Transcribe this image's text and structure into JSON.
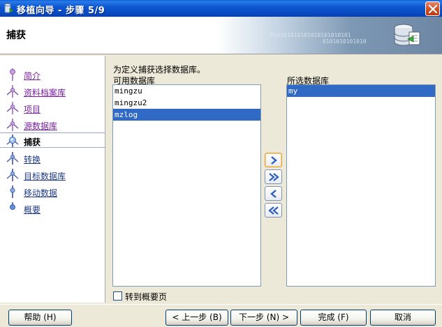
{
  "window": {
    "title": "移植向导 - 步骤 5/9"
  },
  "header": {
    "page_title": "捕获",
    "banner_binary_1": "010101010101010101010101",
    "banner_binary_2": "0101010101010"
  },
  "steps": [
    {
      "label": "简介",
      "state": "visited"
    },
    {
      "label": "资料档案库",
      "state": "visited"
    },
    {
      "label": "项目",
      "state": "visited"
    },
    {
      "label": "源数据库",
      "state": "visited"
    },
    {
      "label": "捕获",
      "state": "current"
    },
    {
      "label": "转换",
      "state": "future"
    },
    {
      "label": "目标数据库",
      "state": "future"
    },
    {
      "label": "移动数据",
      "state": "future"
    },
    {
      "label": "概要",
      "state": "future"
    }
  ],
  "main": {
    "intro": "为定义捕获选择数据库。",
    "available_label": "可用数据库",
    "selected_label": "所选数据库",
    "available": [
      {
        "text": "mingzu",
        "selected": false
      },
      {
        "text": "mingzu2",
        "selected": false
      },
      {
        "text": "mzlog",
        "selected": true
      }
    ],
    "chosen": [
      {
        "text": "my",
        "selected": true
      }
    ],
    "move_buttons": [
      "move-right",
      "move-all-right",
      "move-left",
      "move-all-left"
    ],
    "checkbox_label": "转到概要页",
    "checkbox_checked": false
  },
  "buttons": {
    "help": "帮助 (H)",
    "back": "< 上一步 (B)",
    "next": "下一步 (N) >",
    "finish": "完成 (F)",
    "cancel": "取消"
  },
  "colors": {
    "titlebar": "#0a4fc8",
    "selection": "#316ac5",
    "visited_link": "#7a1fa0",
    "future_link": "#1f3a8a"
  }
}
